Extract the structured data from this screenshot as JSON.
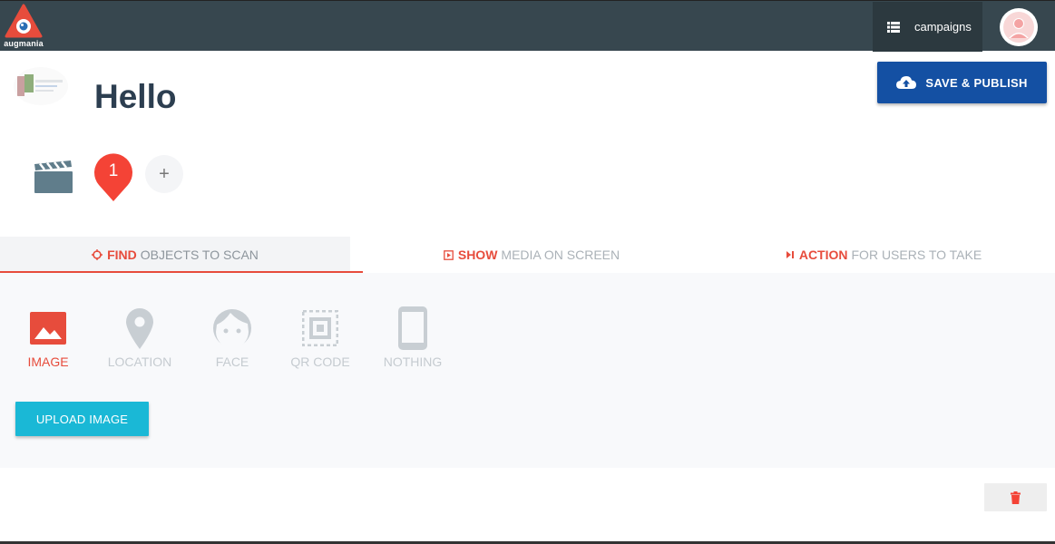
{
  "app": {
    "logo_text": "augmania"
  },
  "topbar": {
    "campaigns_label": "campaigns"
  },
  "campaign": {
    "title": "Hello"
  },
  "toolbar": {
    "save_label": "SAVE & PUBLISH"
  },
  "scenes": {
    "items": [
      {
        "number": "1"
      }
    ],
    "add_label": "+"
  },
  "tabs": [
    {
      "strong": "FIND",
      "rest": "OBJECTS TO SCAN",
      "icon": "crosshair-icon"
    },
    {
      "strong": "SHOW",
      "rest": "MEDIA ON SCREEN",
      "icon": "media-icon"
    },
    {
      "strong": "ACTION",
      "rest": "FOR USERS TO TAKE",
      "icon": "skip-icon"
    }
  ],
  "targets": [
    {
      "label": "IMAGE",
      "icon": "image-icon",
      "active": true
    },
    {
      "label": "LOCATION",
      "icon": "location-pin-icon",
      "active": false
    },
    {
      "label": "FACE",
      "icon": "face-icon",
      "active": false
    },
    {
      "label": "QR CODE",
      "icon": "qr-code-icon",
      "active": false
    },
    {
      "label": "NOTHING",
      "icon": "phone-icon",
      "active": false
    }
  ],
  "upload": {
    "label": "UPLOAD IMAGE"
  },
  "colors": {
    "accent": "#e74c3c",
    "primary": "#1450a3",
    "cyan": "#1ab8d6",
    "topbar": "#37474f"
  }
}
